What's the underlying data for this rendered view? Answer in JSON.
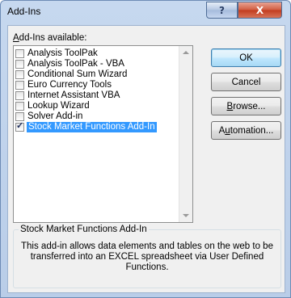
{
  "window": {
    "title": "Add-Ins",
    "help_label": "?",
    "close_label": "X"
  },
  "list": {
    "label_prefix": "",
    "label_underlined": "A",
    "label_rest": "dd-Ins available:",
    "items": [
      {
        "label": "Analysis ToolPak",
        "checked": false,
        "selected": false
      },
      {
        "label": "Analysis ToolPak - VBA",
        "checked": false,
        "selected": false
      },
      {
        "label": "Conditional Sum Wizard",
        "checked": false,
        "selected": false
      },
      {
        "label": "Euro Currency Tools",
        "checked": false,
        "selected": false
      },
      {
        "label": "Internet Assistant VBA",
        "checked": false,
        "selected": false
      },
      {
        "label": "Lookup Wizard",
        "checked": false,
        "selected": false
      },
      {
        "label": "Solver Add-in",
        "checked": false,
        "selected": false
      },
      {
        "label": "Stock Market Functions Add-In",
        "checked": true,
        "selected": true
      }
    ]
  },
  "buttons": {
    "ok": "OK",
    "cancel": "Cancel",
    "browse": {
      "underlined": "B",
      "rest": "rowse..."
    },
    "automation": {
      "pre": "A",
      "underlined": "u",
      "rest": "tomation..."
    }
  },
  "description": {
    "title": "Stock Market Functions Add-In",
    "text": "This add-in allows data elements and tables on the web to be transferred into an EXCEL spreadsheet via User Defined Functions."
  }
}
